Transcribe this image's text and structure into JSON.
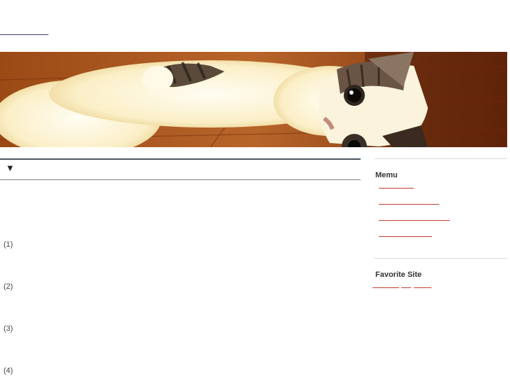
{
  "header": {
    "site_title": ""
  },
  "banner": {
    "alt": "cat-banner-photo"
  },
  "main": {
    "entry_marker": "▼",
    "items": [
      {
        "label": "(1)"
      },
      {
        "label": "(2)"
      },
      {
        "label": "(3)"
      },
      {
        "label": "(4)"
      }
    ]
  },
  "sidebar": {
    "memu_heading": "Memu",
    "memu_links": [
      "",
      "",
      "",
      ""
    ],
    "favorite_heading": "Favorite Site",
    "favorite_links": [
      "",
      "",
      ""
    ]
  },
  "colors": {
    "link_red": "#c53b2f",
    "rule_dark": "#4a5560",
    "divider": "#b7b7b7"
  }
}
